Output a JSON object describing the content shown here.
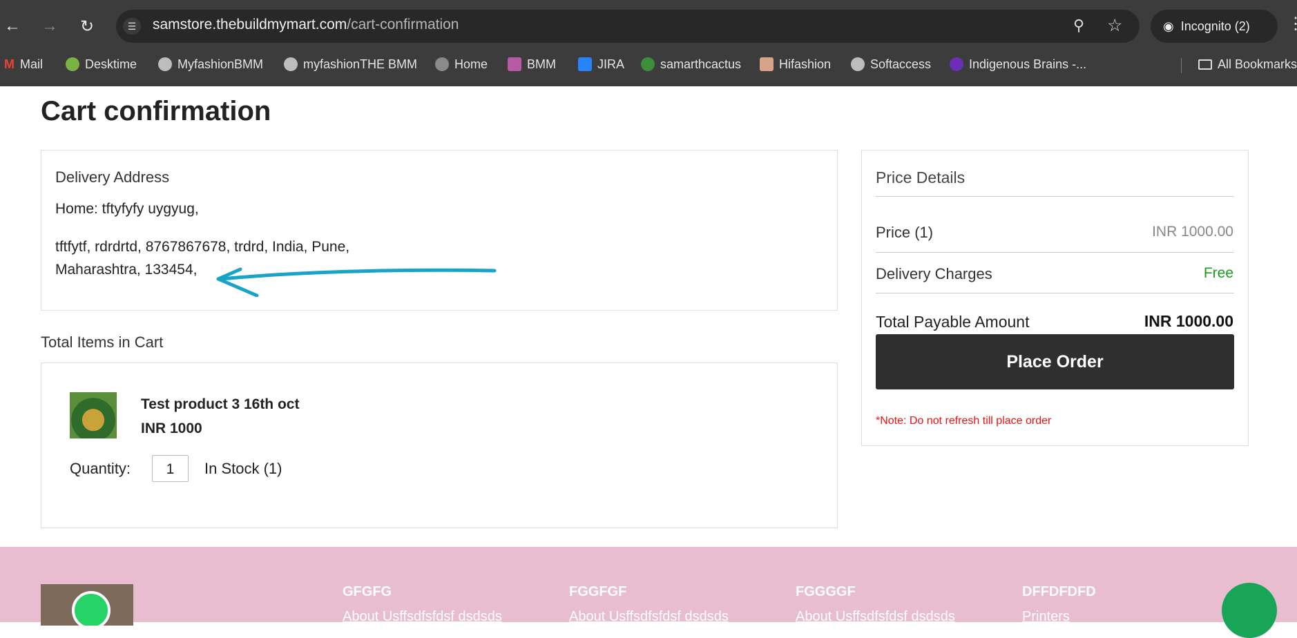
{
  "browser": {
    "url_domain": "samstore.thebuildmymart.com",
    "url_path": "/cart-confirmation",
    "incognito_label": "Incognito (2)",
    "bookmarks": [
      "Mail",
      "Desktime",
      "MyfashionBMM",
      "myfashionTHE BMM",
      "Home",
      "BMM",
      "JIRA",
      "samarthcactus",
      "Hifashion",
      "Softaccess",
      "Indigenous Brains -...",
      "All Bookmarks"
    ]
  },
  "page": {
    "title": "Cart confirmation"
  },
  "delivery": {
    "heading": "Delivery Address",
    "line1": "Home: tftyfyfy uygyug,",
    "line2": "tftfytf, rdrdrtd, 8767867678, trdrd, India, Pune,",
    "line3": "Maharashtra, 133454,"
  },
  "cart": {
    "heading": "Total Items in Cart",
    "item": {
      "name": "Test product 3 16th oct",
      "price": "INR 1000",
      "quantity_label": "Quantity:",
      "quantity": "1",
      "stock": "In Stock (1)"
    }
  },
  "price_details": {
    "heading": "Price Details",
    "price_label": "Price  (1)",
    "price_value": "INR 1000.00",
    "delivery_label": "Delivery Charges",
    "delivery_value": "Free",
    "total_label": "Total Payable Amount",
    "total_value": "INR  1000.00",
    "button": "Place Order",
    "note": "*Note: Do not refresh till place order"
  },
  "footer": {
    "columns": [
      {
        "heading": "GFGFG",
        "link": "About Usffsdfsfdsf dsdsds"
      },
      {
        "heading": "FGGFGF",
        "link": "About Usffsdfsfdsf dsdsds"
      },
      {
        "heading": "FGGGGF",
        "link": "About Usffsdfsfdsf dsdsds"
      },
      {
        "heading": "DFFDFDFD",
        "link": "Printers"
      }
    ]
  },
  "colors": {
    "free": "#1a9c1a",
    "note": "#e11111",
    "annotation_arrow": "#1aa3c8",
    "footer_bg": "#e8bdd0"
  }
}
